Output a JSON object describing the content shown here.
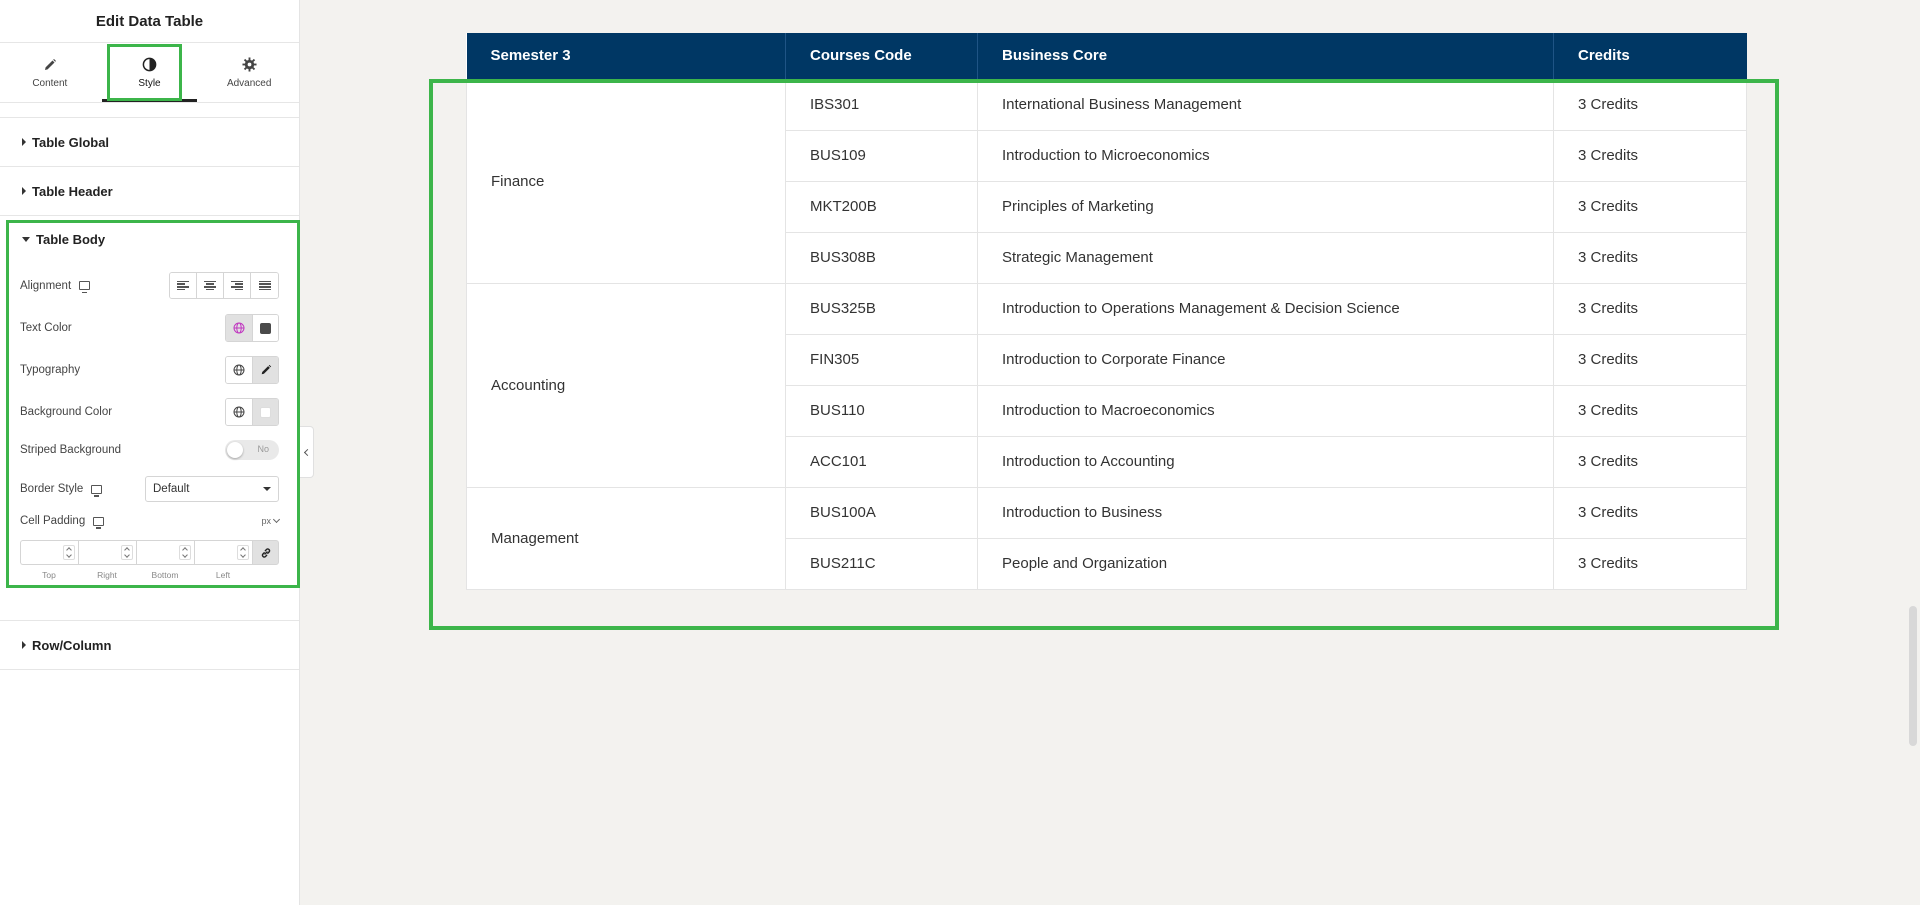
{
  "panel": {
    "title": "Edit Data Table",
    "tabs": [
      {
        "label": "Content",
        "icon": "pencil-icon"
      },
      {
        "label": "Style",
        "icon": "half-circle-icon"
      },
      {
        "label": "Advanced",
        "icon": "gear-icon"
      }
    ],
    "sections": {
      "global": "Table Global",
      "header": "Table Header",
      "body": "Table Body",
      "rowcol": "Row/Column"
    },
    "controls": {
      "alignment": "Alignment",
      "text_color": "Text Color",
      "typography": "Typography",
      "background_color": "Background Color",
      "striped_background": "Striped Background",
      "striped_value": "No",
      "border_style": "Border Style",
      "border_style_value": "Default",
      "cell_padding": "Cell Padding",
      "unit": "px",
      "padding_labels": [
        "Top",
        "Right",
        "Bottom",
        "Left"
      ]
    },
    "colors": {
      "text_swatch": "#4a4a4a",
      "bg_swatch": "#ffffff",
      "global_icon_active": "#c036c0",
      "highlight": "#3cb54a"
    }
  },
  "table": {
    "headers": [
      "Semester 3",
      "Courses Code",
      "Business Core",
      "Credits"
    ],
    "header_bg": "#003764",
    "groups": [
      {
        "name": "Finance",
        "rows": [
          {
            "code": "IBS301",
            "course": "International Business Management",
            "credits": "3 Credits"
          },
          {
            "code": "BUS109",
            "course": "Introduction to Microeconomics",
            "credits": "3 Credits"
          },
          {
            "code": "MKT200B",
            "course": "Principles of Marketing",
            "credits": "3 Credits"
          },
          {
            "code": "BUS308B",
            "course": "Strategic Management",
            "credits": "3 Credits"
          }
        ]
      },
      {
        "name": "Accounting",
        "rows": [
          {
            "code": "BUS325B",
            "course": "Introduction to Operations Management & Decision Science",
            "credits": "3 Credits"
          },
          {
            "code": "FIN305",
            "course": "Introduction to Corporate Finance",
            "credits": "3 Credits"
          },
          {
            "code": "BUS110",
            "course": "Introduction to Macroeconomics",
            "credits": "3 Credits"
          },
          {
            "code": "ACC101",
            "course": "Introduction to Accounting",
            "credits": "3 Credits"
          }
        ]
      },
      {
        "name": "Management",
        "rows": [
          {
            "code": "BUS100A",
            "course": "Introduction to Business",
            "credits": "3 Credits"
          },
          {
            "code": "BUS211C",
            "course": "People and Organization",
            "credits": "3 Credits"
          }
        ]
      }
    ]
  }
}
